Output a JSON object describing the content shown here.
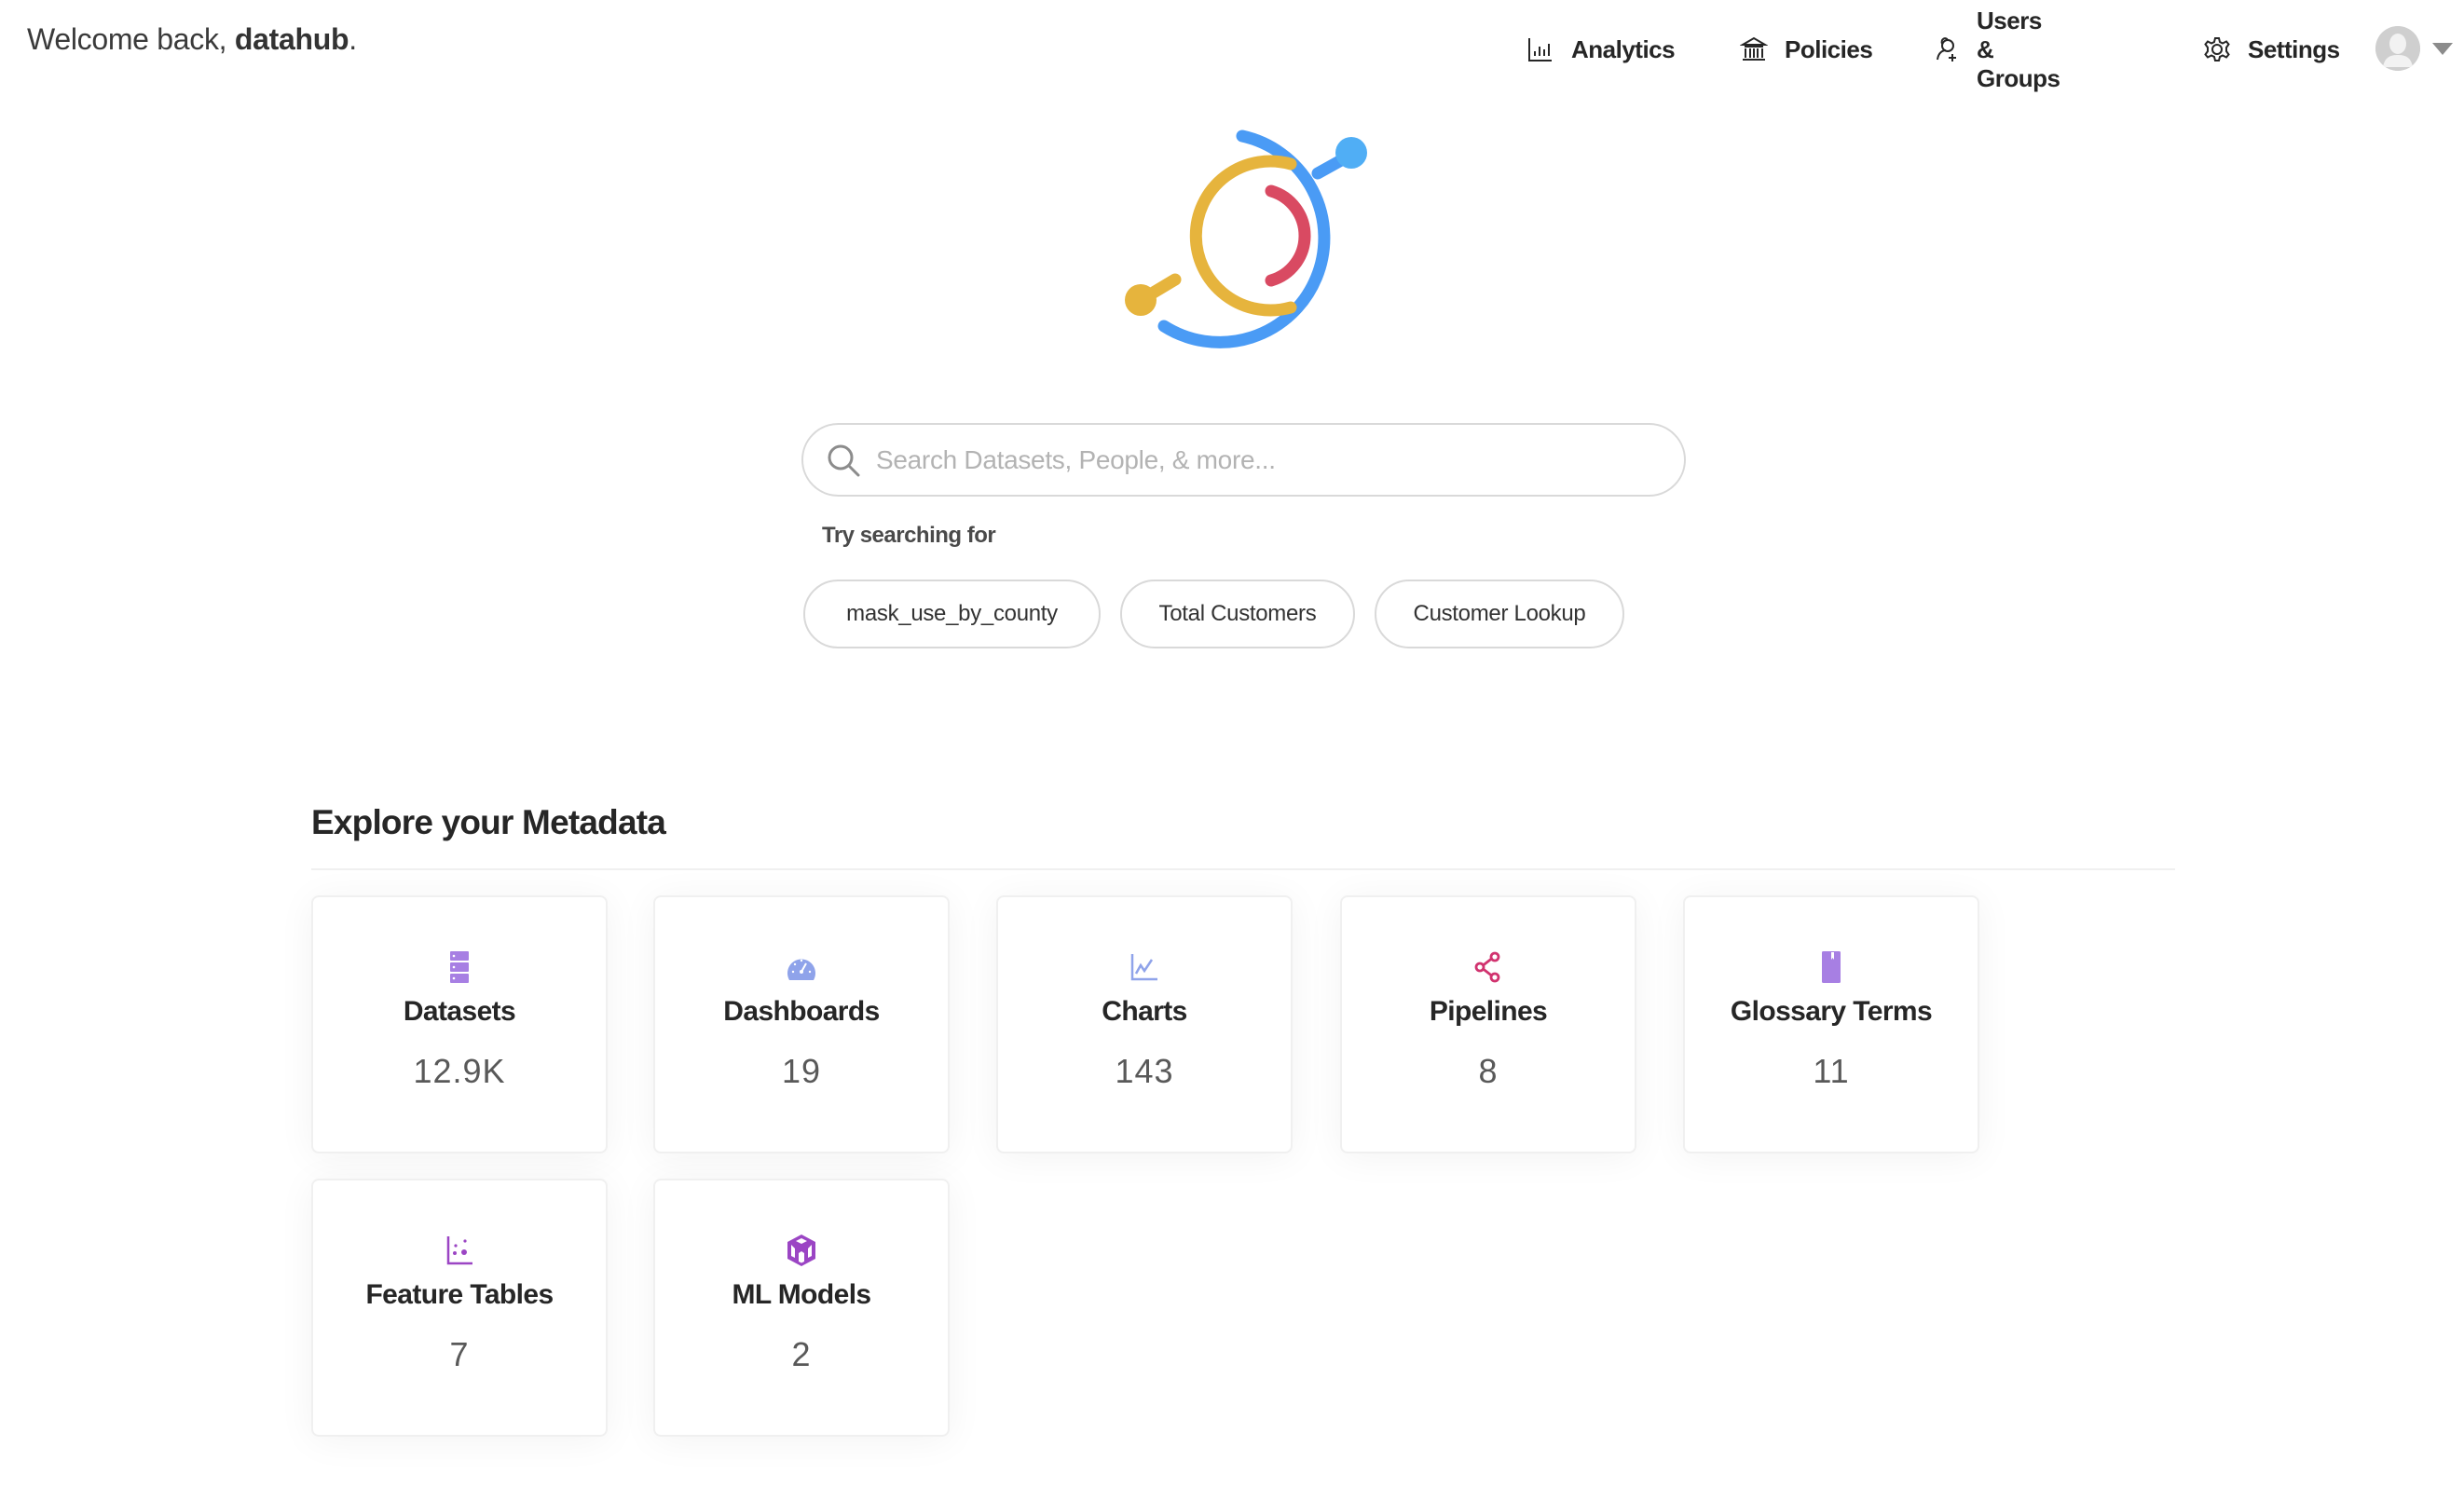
{
  "header": {
    "welcome_prefix": "Welcome back, ",
    "username": "datahub",
    "welcome_suffix": "."
  },
  "nav": {
    "items": [
      {
        "label": "Analytics",
        "icon": "bar-chart-icon"
      },
      {
        "label": "Policies",
        "icon": "bank-icon"
      },
      {
        "label": "Users & Groups",
        "icon": "user-add-icon"
      },
      {
        "label": "Settings",
        "icon": "gear-icon"
      }
    ],
    "avatar_icon": "user-avatar-icon",
    "menu_icon": "caret-down-icon"
  },
  "logo": {
    "colors": {
      "yellow": "#E9B43A",
      "red": "#D94A62",
      "blue": "#4A9BF5"
    }
  },
  "search": {
    "placeholder": "Search Datasets, People, & more...",
    "value": "",
    "try_label": "Try searching for",
    "suggestions": [
      "mask_use_by_county",
      "Total Customers",
      "Customer Lookup"
    ]
  },
  "explore": {
    "title": "Explore your Metadata",
    "cards": [
      {
        "label": "Datasets",
        "count": "12.9K",
        "icon": "database-icon",
        "color": "#A77FE3"
      },
      {
        "label": "Dashboards",
        "count": "19",
        "icon": "dashboard-gauge-icon",
        "color": "#8FA3EA"
      },
      {
        "label": "Charts",
        "count": "143",
        "icon": "line-chart-icon",
        "color": "#8FA3EA"
      },
      {
        "label": "Pipelines",
        "count": "8",
        "icon": "share-nodes-icon",
        "color": "#D1336F"
      },
      {
        "label": "Glossary Terms",
        "count": "11",
        "icon": "book-icon",
        "color": "#A77FE3"
      },
      {
        "label": "Feature Tables",
        "count": "7",
        "icon": "dot-chart-icon",
        "color": "#9B45C4"
      },
      {
        "label": "ML Models",
        "count": "2",
        "icon": "code-sandbox-icon",
        "color": "#9B45C4"
      }
    ]
  }
}
